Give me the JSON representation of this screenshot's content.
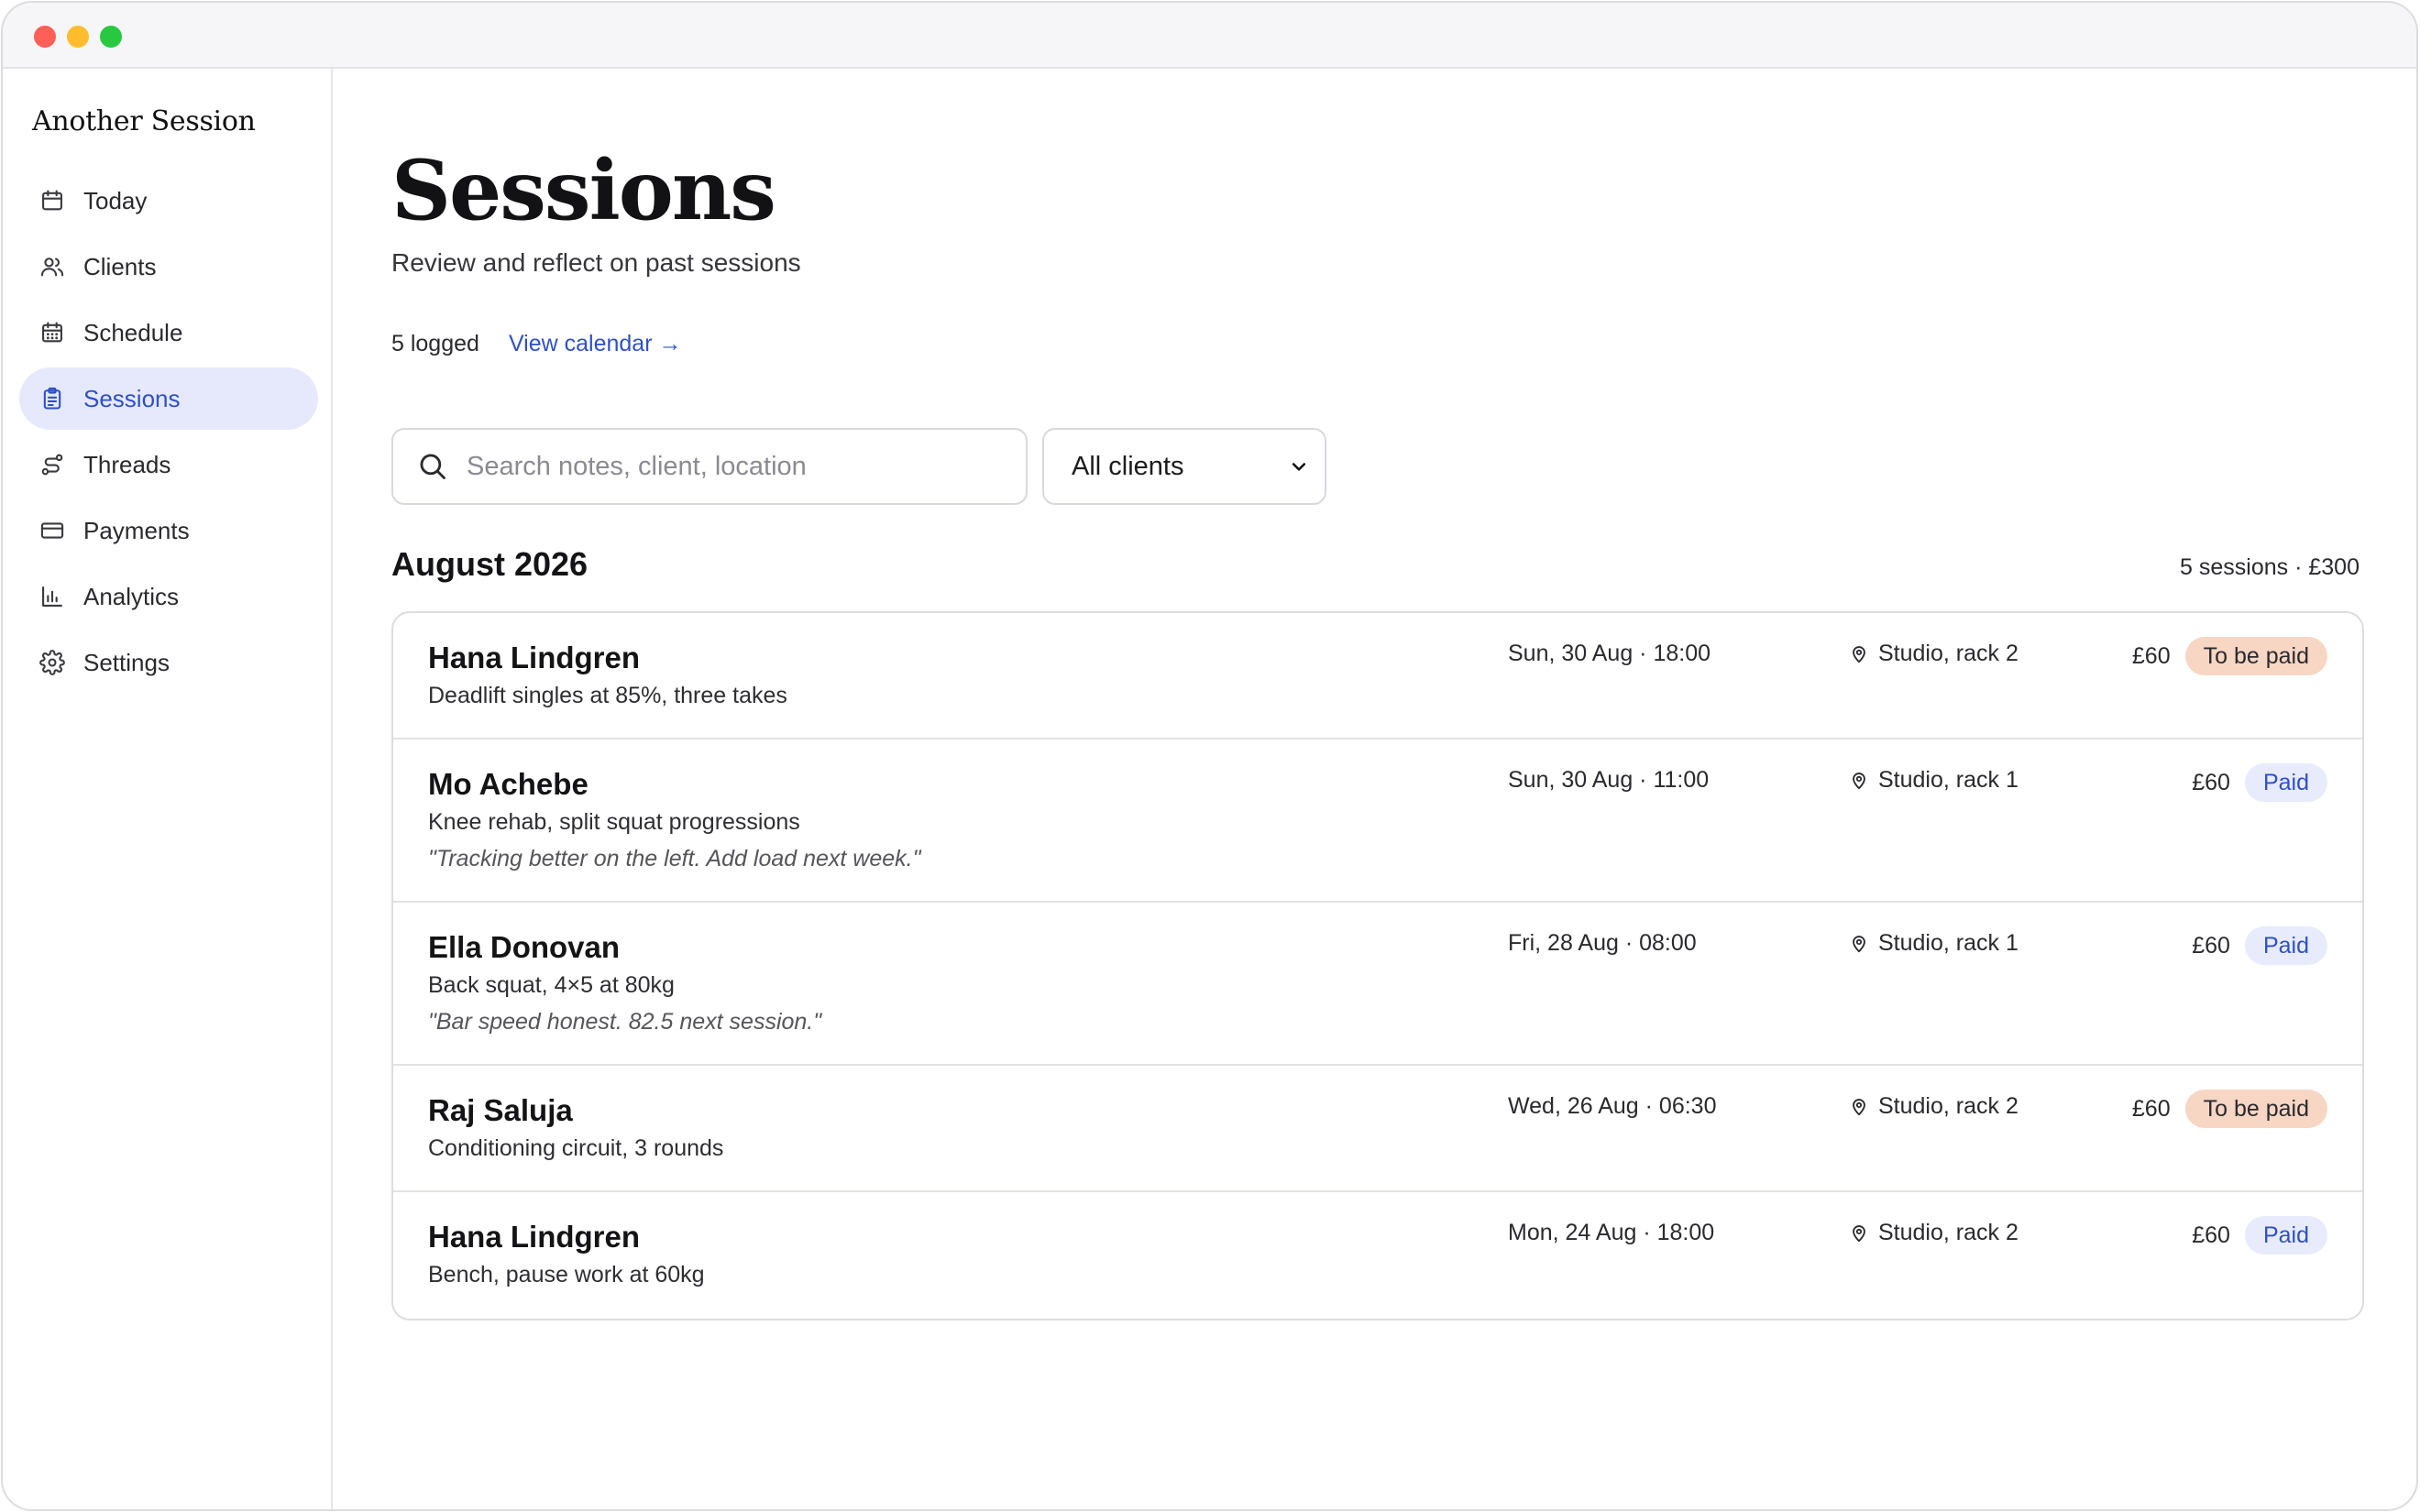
{
  "app": {
    "name": "Another Session"
  },
  "sidebar": {
    "items": [
      {
        "label": "Today",
        "icon": "calendar-icon"
      },
      {
        "label": "Clients",
        "icon": "users-icon"
      },
      {
        "label": "Schedule",
        "icon": "calendar-grid-icon"
      },
      {
        "label": "Sessions",
        "icon": "clipboard-icon",
        "active": true
      },
      {
        "label": "Threads",
        "icon": "route-icon"
      },
      {
        "label": "Payments",
        "icon": "credit-card-icon"
      },
      {
        "label": "Analytics",
        "icon": "bar-chart-icon"
      },
      {
        "label": "Settings",
        "icon": "gear-icon"
      }
    ]
  },
  "page": {
    "title": "Sessions",
    "subtitle": "Review and reflect on past sessions",
    "logged_count": "5 logged",
    "calendar_link": "View calendar →"
  },
  "filters": {
    "search_placeholder": "Search notes, client, location",
    "client_select": "All clients"
  },
  "group": {
    "month": "August 2026",
    "summary": "5 sessions · £300"
  },
  "sessions": [
    {
      "client": "Hana Lindgren",
      "description": "Deadlift singles at 85%, three takes",
      "note": "",
      "datetime": "Sun, 30 Aug · 18:00",
      "location": "Studio, rack 2",
      "price": "£60",
      "status": "To be paid"
    },
    {
      "client": "Mo Achebe",
      "description": "Knee rehab, split squat progressions",
      "note": "\"Tracking better on the left. Add load next week.\"",
      "datetime": "Sun, 30 Aug · 11:00",
      "location": "Studio, rack 1",
      "price": "£60",
      "status": "Paid"
    },
    {
      "client": "Ella Donovan",
      "description": "Back squat, 4×5 at 80kg",
      "note": "\"Bar speed honest. 82.5 next session.\"",
      "datetime": "Fri, 28 Aug · 08:00",
      "location": "Studio, rack 1",
      "price": "£60",
      "status": "Paid"
    },
    {
      "client": "Raj Saluja",
      "description": "Conditioning circuit, 3 rounds",
      "note": "",
      "datetime": "Wed, 26 Aug · 06:30",
      "location": "Studio, rack 2",
      "price": "£60",
      "status": "To be paid"
    },
    {
      "client": "Hana Lindgren",
      "description": "Bench, pause work at 60kg",
      "note": "",
      "datetime": "Mon, 24 Aug · 18:00",
      "location": "Studio, rack 2",
      "price": "£60",
      "status": "Paid"
    }
  ],
  "colors": {
    "accent": "#2e50c8",
    "active_nav_bg": "#e6e9fb",
    "paid_badge_bg": "#e8ebfb",
    "due_badge_bg": "#f7d6c4"
  }
}
